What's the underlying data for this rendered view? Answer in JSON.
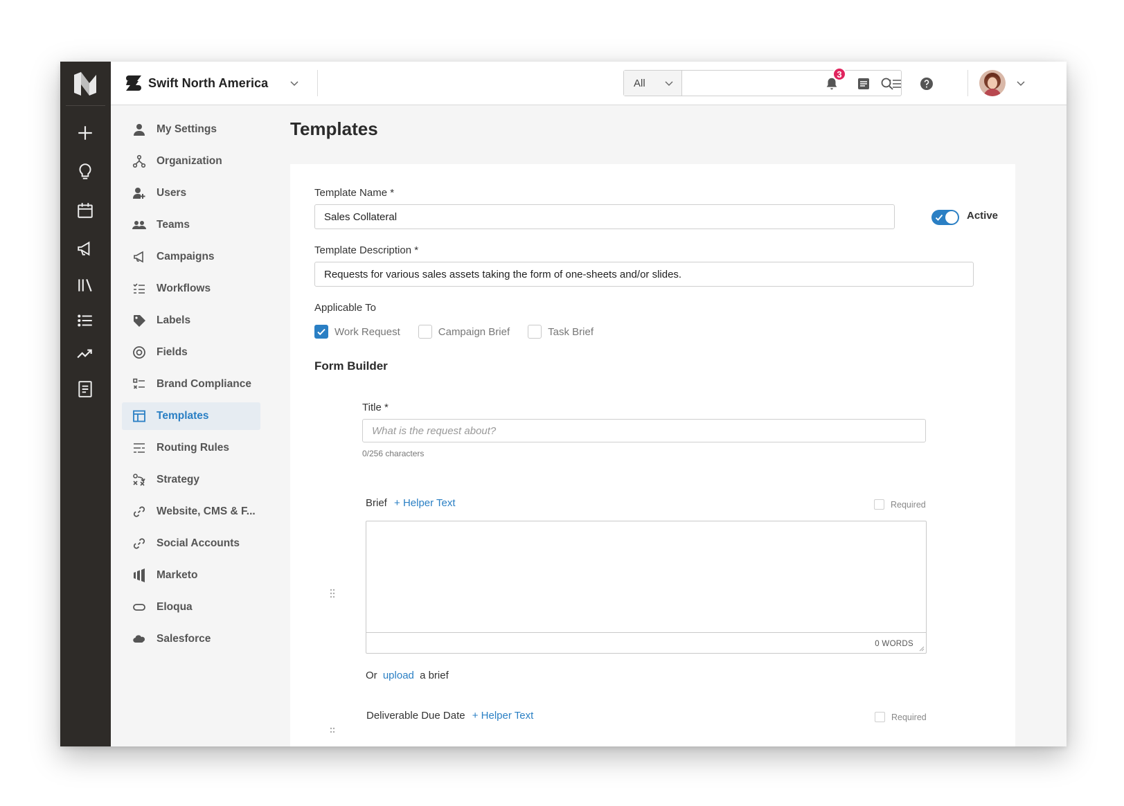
{
  "header": {
    "workspace_name": "Swift North America",
    "search": {
      "scope": "All",
      "placeholder": ""
    },
    "notifications_count": "3"
  },
  "settings_nav": {
    "items": [
      {
        "label": "My Settings",
        "icon": "person-icon"
      },
      {
        "label": "Organization",
        "icon": "org-tree-icon"
      },
      {
        "label": "Users",
        "icon": "user-add-icon"
      },
      {
        "label": "Teams",
        "icon": "team-icon"
      },
      {
        "label": "Campaigns",
        "icon": "megaphone-icon"
      },
      {
        "label": "Workflows",
        "icon": "workflow-icon"
      },
      {
        "label": "Labels",
        "icon": "tag-icon"
      },
      {
        "label": "Fields",
        "icon": "target-icon"
      },
      {
        "label": "Brand Compliance",
        "icon": "checklist-icon"
      },
      {
        "label": "Templates",
        "icon": "template-icon",
        "active": true
      },
      {
        "label": "Routing Rules",
        "icon": "routing-icon"
      },
      {
        "label": "Strategy",
        "icon": "strategy-icon"
      },
      {
        "label": "Website, CMS & F...",
        "icon": "link-icon"
      },
      {
        "label": "Social Accounts",
        "icon": "link-icon"
      },
      {
        "label": "Marketo",
        "icon": "marketo-icon"
      },
      {
        "label": "Eloqua",
        "icon": "eloqua-icon"
      },
      {
        "label": "Salesforce",
        "icon": "cloud-icon"
      }
    ]
  },
  "page": {
    "title": "Templates",
    "template_name_label": "Template Name *",
    "template_name_value": "Sales Collateral",
    "active_label": "Active",
    "active": true,
    "description_label": "Template Description *",
    "description_value": "Requests for various sales assets taking the form of one-sheets and/or slides.",
    "applicable_to_label": "Applicable To",
    "applicable_to": [
      {
        "label": "Work Request",
        "checked": true
      },
      {
        "label": "Campaign Brief",
        "checked": false
      },
      {
        "label": "Task Brief",
        "checked": false
      }
    ],
    "form_builder_title": "Form Builder",
    "title_field": {
      "label": "Title *",
      "placeholder": "What is the request about?",
      "char_count": "0/256 characters"
    },
    "brief_field": {
      "label": "Brief",
      "helper_link": "+ Helper Text",
      "required_label": "Required",
      "word_count": "0 WORDS",
      "upload_prefix": "Or",
      "upload_link": "upload",
      "upload_suffix": "a brief"
    },
    "due_date_field": {
      "label": "Deliverable Due Date",
      "helper_link": "+ Helper Text",
      "required_label": "Required"
    }
  },
  "colors": {
    "accent": "#2a7fc4",
    "rail": "#2e2b28",
    "badge": "#e0245e",
    "active_nav_bg": "#e6ecf2"
  }
}
